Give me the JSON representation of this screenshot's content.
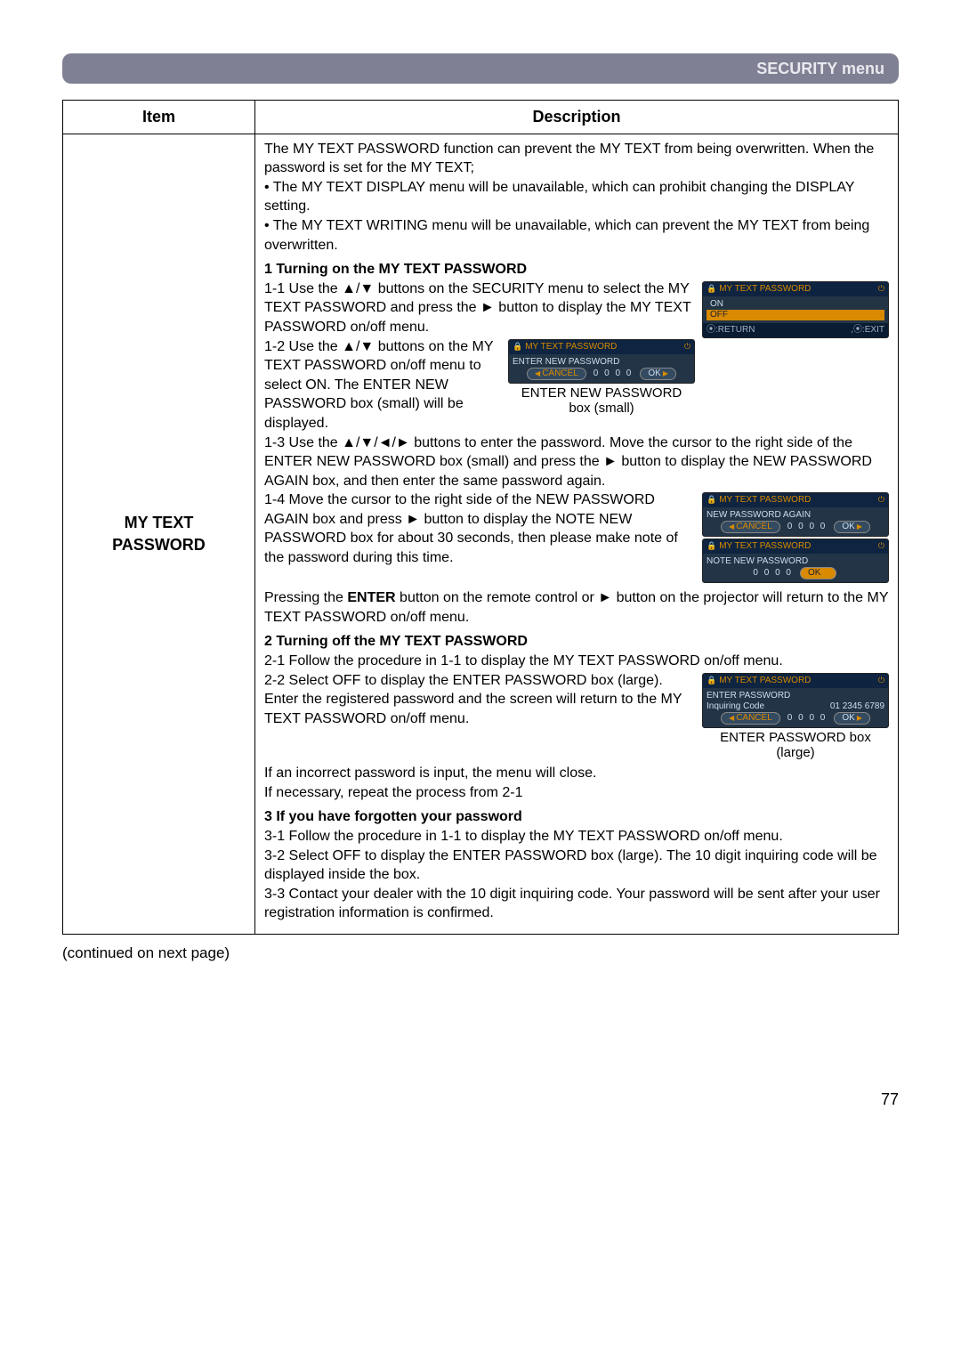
{
  "banner": {
    "title": "SECURITY menu"
  },
  "table": {
    "head_item": "Item",
    "head_desc": "Description",
    "item_label_line1": "MY TEXT",
    "item_label_line2": "PASSWORD"
  },
  "intro": {
    "p1": "The MY TEXT PASSWORD function can prevent the MY TEXT from being overwritten. When the password is set for the MY TEXT;",
    "b1": "• The MY TEXT DISPLAY menu will be unavailable, which can prohibit changing the DISPLAY setting.",
    "b2": "• The MY TEXT WRITING menu will be unavailable, which can prevent the MY TEXT from being overwritten."
  },
  "s1": {
    "head": "1 Turning on the MY TEXT PASSWORD",
    "p11": "1-1 Use the ▲/▼ buttons on the SECURITY menu to select the MY TEXT PASSWORD and press the ► button to display the MY TEXT PASSWORD on/off menu.",
    "p12": "1-2 Use the ▲/▼ buttons on the MY TEXT PASSWORD on/off menu to select ON. The ENTER NEW PASSWORD box (small) will be displayed.",
    "p13": "1-3 Use the ▲/▼/◄/► buttons to enter the password. Move the cursor to the right side of the ENTER NEW PASSWORD box (small) and press the ► button to display the NEW PASSWORD AGAIN box, and then enter the same password again.",
    "p14": "1-4 Move the cursor to the right side of the NEW PASSWORD AGAIN box and press ► button to display the NOTE NEW PASSWORD box for about 30 seconds, then please make note of the password during this time.",
    "tail": "Pressing the ENTER button on the remote control or ► button on the projector will return to the MY TEXT PASSWORD on/off menu."
  },
  "s2": {
    "head": "2 Turning off the MY TEXT PASSWORD",
    "p21": "2-1 Follow the procedure in 1-1 to display the MY TEXT PASSWORD on/off menu.",
    "p22": "2-2 Select OFF to display the ENTER PASSWORD box (large). Enter the registered password and the screen will return to the MY TEXT PASSWORD on/off menu.",
    "tail1": "If an incorrect password is input, the menu will close.",
    "tail2": "If necessary, repeat the process from 2-1"
  },
  "s3": {
    "head": "3 If you have forgotten your password",
    "p31": "3-1 Follow the procedure in 1-1 to display the MY TEXT PASSWORD on/off menu.",
    "p32": "3-2 Select OFF to display the ENTER PASSWORD box (large). The 10 digit inquiring code will be displayed inside the box.",
    "p33": "3-3 Contact your dealer with the 10 digit inquiring code. Your password will be sent after your user registration information is confirmed."
  },
  "fig": {
    "title": "MY TEXT PASSWORD",
    "on": "ON",
    "off": "OFF",
    "return": "⦿:RETURN",
    "exit": ",⦿:EXIT",
    "enter_new": "ENTER NEW PASSWORD",
    "again": "NEW PASSWORD AGAIN",
    "note": "NOTE NEW PASSWORD",
    "enter_pw": "ENTER PASSWORD",
    "inquiring": "Inquiring Code",
    "code": "01 2345 6789",
    "cancel": "CANCEL",
    "ok": "OK",
    "digits": "0 0 0 0",
    "cap_small1": "ENTER NEW PASSWORD",
    "cap_small2": "box (small)",
    "cap_large1": "ENTER PASSWORD box",
    "cap_large2": "(large)"
  },
  "cont": "(continued on next page)",
  "page": "77"
}
